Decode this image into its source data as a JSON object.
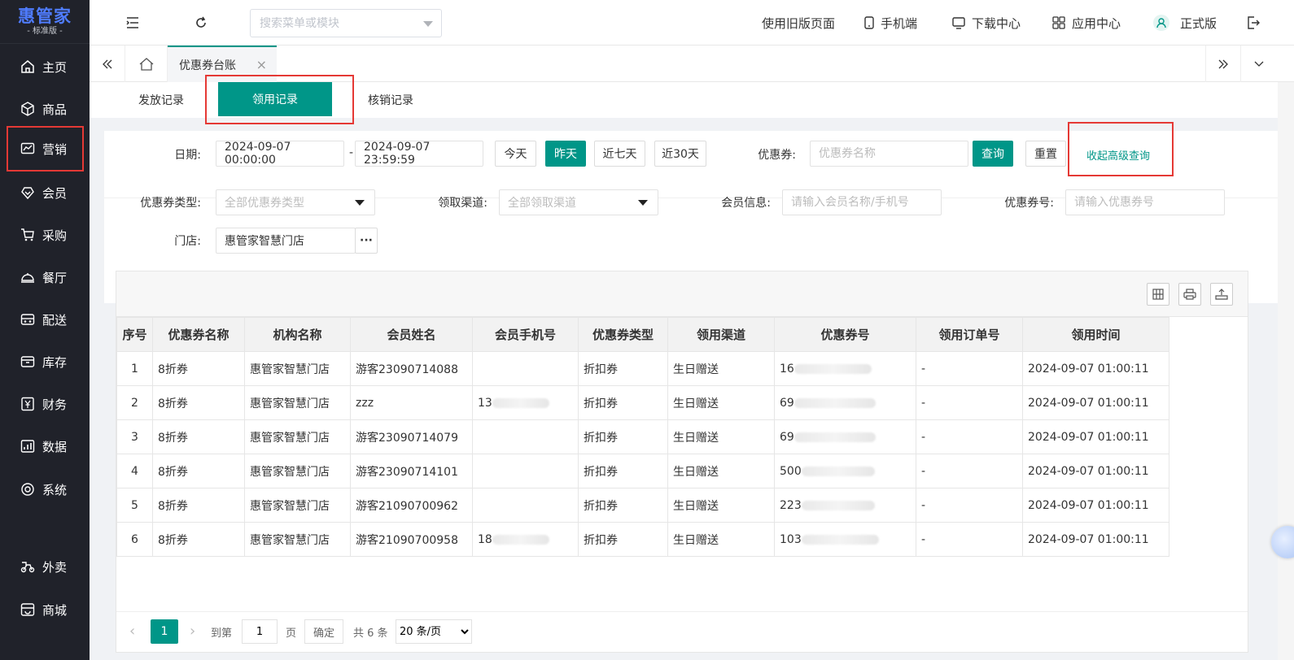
{
  "brand": {
    "name": "惠管家",
    "edition": "- 标准版 -"
  },
  "sidebar": {
    "items": [
      {
        "label": "主页",
        "icon": "home-icon"
      },
      {
        "label": "商品",
        "icon": "cube-icon"
      },
      {
        "label": "营销",
        "icon": "chart-icon"
      },
      {
        "label": "会员",
        "icon": "diamond-icon"
      },
      {
        "label": "采购",
        "icon": "cart-icon"
      },
      {
        "label": "餐厅",
        "icon": "cloche-icon"
      },
      {
        "label": "配送",
        "icon": "delivery-icon"
      },
      {
        "label": "库存",
        "icon": "box-icon"
      },
      {
        "label": "财务",
        "icon": "yen-icon"
      },
      {
        "label": "数据",
        "icon": "bar-chart-icon"
      },
      {
        "label": "系统",
        "icon": "gear-icon"
      },
      {
        "label": "外卖",
        "icon": "scooter-icon"
      },
      {
        "label": "商城",
        "icon": "shop-icon"
      }
    ]
  },
  "header": {
    "search_placeholder": "搜索菜单或模块",
    "links": {
      "old_page": "使用旧版页面",
      "mobile": "手机端",
      "download": "下载中心",
      "apps": "应用中心",
      "version": "正式版"
    }
  },
  "tabs": {
    "current": "优惠券台账",
    "close": "×"
  },
  "subtabs": {
    "issue": "发放记录",
    "receive": "领用记录",
    "writeoff": "核销记录"
  },
  "filter": {
    "date_label": "日期:",
    "date_start": "2024-09-07 00:00:00",
    "date_end": "2024-09-07 23:59:59",
    "date_sep": "-",
    "quick": {
      "today": "今天",
      "yesterday": "昨天",
      "week": "近七天",
      "month": "近30天"
    },
    "coupon_label": "优惠券:",
    "coupon_placeholder": "优惠券名称",
    "query": "查询",
    "reset": "重置",
    "advanced": "收起高级查询",
    "type_label": "优惠券类型:",
    "type_value": "全部优惠券类型",
    "channel_label": "领取渠道:",
    "channel_value": "全部领取渠道",
    "member_label": "会员信息:",
    "member_placeholder": "请输入会员名称/手机号",
    "couponno_label": "优惠券号:",
    "couponno_placeholder": "请输入优惠券号",
    "store_label": "门店:",
    "store_value": "惠管家智慧门店",
    "store_more": "···"
  },
  "table": {
    "headers": [
      "序号",
      "优惠券名称",
      "机构名称",
      "会员姓名",
      "会员手机号",
      "优惠券类型",
      "领用渠道",
      "优惠券号",
      "领用订单号",
      "领用时间"
    ],
    "rows": [
      {
        "no": "1",
        "name": "8折券",
        "org": "惠管家智慧门店",
        "member": "游客23090714088",
        "phone": "",
        "type": "折扣券",
        "channel": "生日赠送",
        "coupon": "16",
        "order": "-",
        "time": "2024-09-07 01:00:11"
      },
      {
        "no": "2",
        "name": "8折券",
        "org": "惠管家智慧门店",
        "member": "zzz",
        "phone": "13",
        "type": "折扣券",
        "channel": "生日赠送",
        "coupon": "69",
        "order": "-",
        "time": "2024-09-07 01:00:11"
      },
      {
        "no": "3",
        "name": "8折券",
        "org": "惠管家智慧门店",
        "member": "游客23090714079",
        "phone": "",
        "type": "折扣券",
        "channel": "生日赠送",
        "coupon": "69",
        "order": "-",
        "time": "2024-09-07 01:00:11"
      },
      {
        "no": "4",
        "name": "8折券",
        "org": "惠管家智慧门店",
        "member": "游客23090714101",
        "phone": "",
        "type": "折扣券",
        "channel": "生日赠送",
        "coupon": "500",
        "order": "-",
        "time": "2024-09-07 01:00:11"
      },
      {
        "no": "5",
        "name": "8折券",
        "org": "惠管家智慧门店",
        "member": "游客21090700962",
        "phone": "",
        "type": "折扣券",
        "channel": "生日赠送",
        "coupon": "223",
        "order": "-",
        "time": "2024-09-07 01:00:11"
      },
      {
        "no": "6",
        "name": "8折券",
        "org": "惠管家智慧门店",
        "member": "游客21090700958",
        "phone": "18",
        "type": "折扣券",
        "channel": "生日赠送",
        "coupon": "103",
        "order": "-",
        "time": "2024-09-07 01:00:11"
      }
    ]
  },
  "pager": {
    "current": "1",
    "goto": "到第",
    "page_input": "1",
    "page": "页",
    "confirm": "确定",
    "total": "共 6 条",
    "page_size": "20 条/页"
  },
  "colors": {
    "accent": "#009688",
    "sidebar_bg": "#20222a",
    "highlight": "#e53935",
    "brand_blue": "#4f7cff"
  }
}
